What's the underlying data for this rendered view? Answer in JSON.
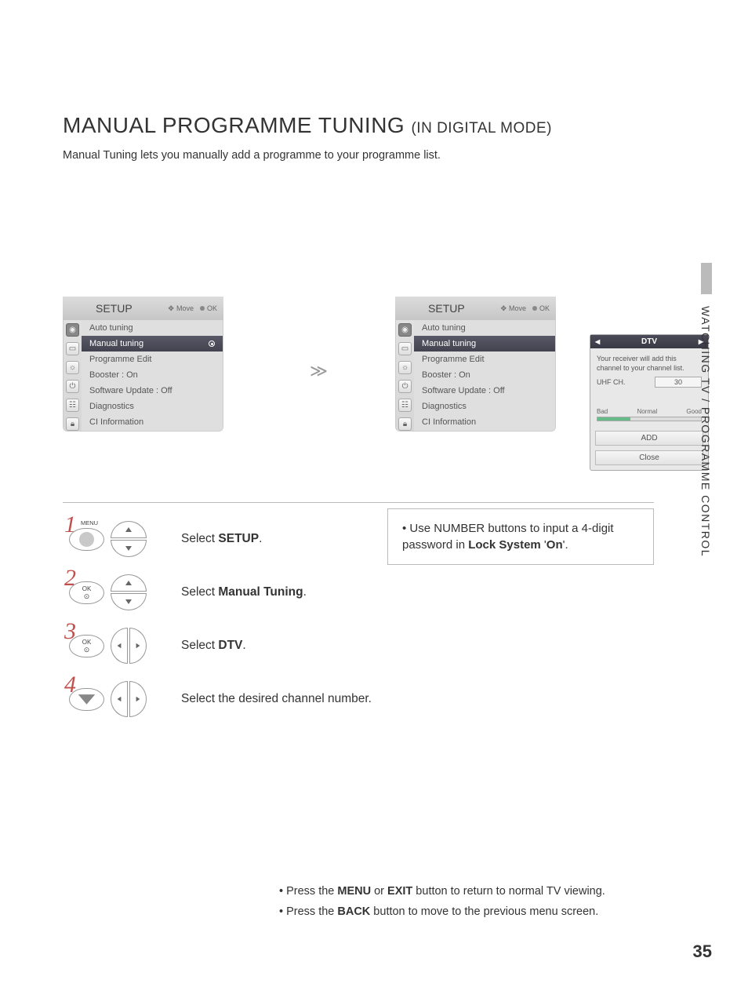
{
  "title_main": "MANUAL PROGRAMME TUNING ",
  "title_sub": "(IN DIGITAL MODE)",
  "intro": "Manual Tuning lets you manually add a programme to your programme list.",
  "side_label": "WATCHING TV / PROGRAMME CONTROL",
  "page_number": "35",
  "osd_hints_move": "Move",
  "osd_hints_ok": "OK",
  "menu_title": "SETUP",
  "menu_items": [
    "Auto tuning",
    "Manual tuning",
    "Programme Edit",
    "Booster             : On",
    "Software Update : Off",
    "Diagnostics",
    "CI Information"
  ],
  "dtv": {
    "title": "DTV",
    "line1": "Your receiver will add this",
    "line2": "channel to your channel list.",
    "uhf_label": "UHF CH.",
    "uhf_value": "30",
    "sig_bad": "Bad",
    "sig_normal": "Normal",
    "sig_good": "Good",
    "btn_add": "ADD",
    "btn_close": "Close"
  },
  "steps": {
    "s1_pre": "Select ",
    "s1_bold": "SETUP",
    "s1_post": ".",
    "s2_pre": "Select ",
    "s2_bold": "Manual Tuning",
    "s2_post": ".",
    "s3_pre": "Select ",
    "s3_bold": "DTV",
    "s3_post": ".",
    "s4": "Select the desired channel number."
  },
  "btn_menu_label": "MENU",
  "btn_ok_label": "OK",
  "note_pre": "• Use NUMBER buttons to input a 4-digit password in ",
  "note_b1": "Lock System",
  "note_mid": " '",
  "note_b2": "On",
  "note_post": "'.",
  "foot1_pre": "• Press the ",
  "foot1_b1": "MENU",
  "foot1_mid": " or ",
  "foot1_b2": "EXIT",
  "foot1_post": " button to return to normal TV viewing.",
  "foot2_pre": "• Press the ",
  "foot2_b1": "BACK",
  "foot2_post": " button to move to the previous menu screen."
}
